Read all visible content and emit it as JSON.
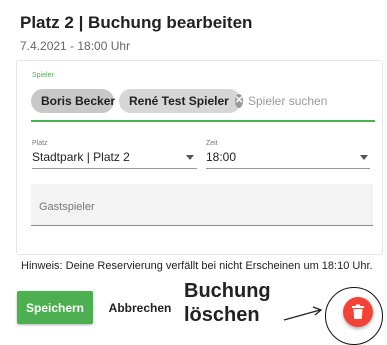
{
  "dialog": {
    "title": "Platz 2 | Buchung bearbeiten",
    "subtitle": "7.4.2021 - 18:00 Uhr"
  },
  "players": {
    "label": "Spieler",
    "chips": [
      "Boris Becker",
      "René Test Spieler"
    ],
    "remove_icon": "cancel-icon",
    "search_placeholder": "Spieler suchen"
  },
  "court": {
    "label": "Platz",
    "value": "Stadtpark | Platz 2"
  },
  "time": {
    "label": "Zeit",
    "value": "18:00"
  },
  "guest": {
    "placeholder": "Gastspieler"
  },
  "hint": "Hinweis: Deine Reservierung verfällt bei nicht Erscheinen um 18:10 Uhr.",
  "actions": {
    "save_label": "Speichern",
    "cancel_label": "Abbrechen",
    "delete_icon": "trash-icon"
  },
  "annotation": {
    "line1": "Buchung",
    "line2": "löschen"
  },
  "colors": {
    "accent": "#4caf50",
    "delete": "#f44336",
    "chip": "#d6d6d6"
  }
}
